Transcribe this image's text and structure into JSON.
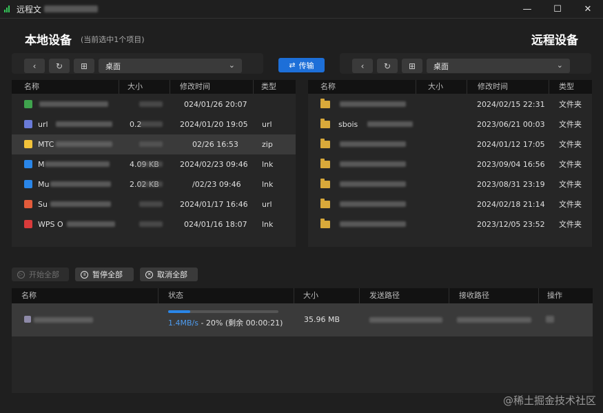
{
  "window": {
    "title": "远程文",
    "controls": {
      "minimize": "—",
      "maximize": "☐",
      "close": "✕"
    }
  },
  "local": {
    "title": "本地设备",
    "subtitle": "(当前选中1个项目)",
    "path": "桌面",
    "columns": [
      "名称",
      "大小",
      "修改时间",
      "类型"
    ],
    "rows": [
      {
        "name": "",
        "size": "",
        "modified": "024/01/26 20:07",
        "type": "",
        "icon_color": "#3fa34d"
      },
      {
        "name": "url",
        "size": "0.2",
        "modified": "2024/01/20 19:05",
        "type": "url",
        "icon_color": "#6a7bd8"
      },
      {
        "name": "MTC",
        "size": "",
        "modified": "02/26 16:53",
        "type": "zip",
        "icon_color": "#f2c23a",
        "selected": true
      },
      {
        "name": "M",
        "size": "4.09 KB",
        "modified": "2024/02/23 09:46",
        "type": "lnk",
        "icon_color": "#2a86e8"
      },
      {
        "name": "Mu",
        "size": "2.02 KB",
        "modified": "/02/23 09:46",
        "type": "lnk",
        "icon_color": "#2a86e8"
      },
      {
        "name": "Su",
        "size": "",
        "modified": "2024/01/17 16:46",
        "type": "url",
        "icon_color": "#e25b3b"
      },
      {
        "name": "WPS O",
        "size": "",
        "modified": "024/01/16 18:07",
        "type": "lnk",
        "icon_color": "#d83b3b"
      }
    ]
  },
  "transfer_button": {
    "label": "传输",
    "icon": "swap-icon"
  },
  "remote": {
    "title": "远程设备",
    "path": "桌面",
    "columns": [
      "名称",
      "大小",
      "修改时间",
      "类型"
    ],
    "rows": [
      {
        "name": "",
        "modified": "2024/02/15 22:31",
        "type": "文件夹"
      },
      {
        "name": "sbois",
        "modified": "2023/06/21 00:03",
        "type": "文件夹"
      },
      {
        "name": "",
        "modified": "2024/01/12 17:05",
        "type": "文件夹"
      },
      {
        "name": "",
        "modified": "2023/09/04 16:56",
        "type": "文件夹"
      },
      {
        "name": "",
        "modified": "2023/08/31 23:19",
        "type": "文件夹"
      },
      {
        "name": "",
        "modified": "2024/02/18 21:14",
        "type": "文件夹"
      },
      {
        "name": "",
        "modified": "2023/12/05 23:52",
        "type": "文件夹"
      }
    ]
  },
  "controls": {
    "start_all": "开始全部",
    "pause_all": "暂停全部",
    "cancel_all": "取消全部"
  },
  "transfers": {
    "columns": [
      "名称",
      "状态",
      "大小",
      "发送路径",
      "接收路径",
      "操作"
    ],
    "rows": [
      {
        "name": "",
        "speed": "1.4MB/s",
        "status_text": " - 20% (剩余 00:00:21)",
        "progress": 0.2,
        "size": "35.96 MB"
      }
    ]
  },
  "watermark": "@稀土掘金技术社区"
}
